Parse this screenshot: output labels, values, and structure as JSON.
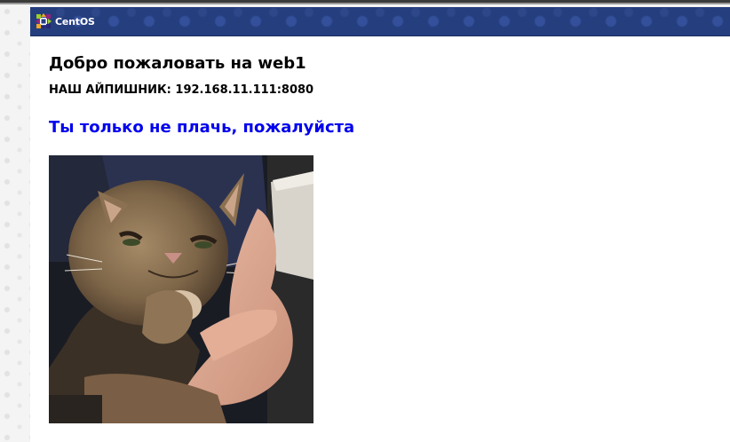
{
  "header": {
    "logo_text": "CentOS",
    "logo_icon": "centos-logo-icon"
  },
  "page": {
    "heading": "Добро пожаловать на web1",
    "ip_line": "НАШ АЙПИШНИК: 192.168.11.111:8080",
    "link_text": "Ты только не плачь, пожалуйста"
  },
  "colors": {
    "header_bg": "#253e7e",
    "link": "#0000ee",
    "text": "#000000"
  }
}
